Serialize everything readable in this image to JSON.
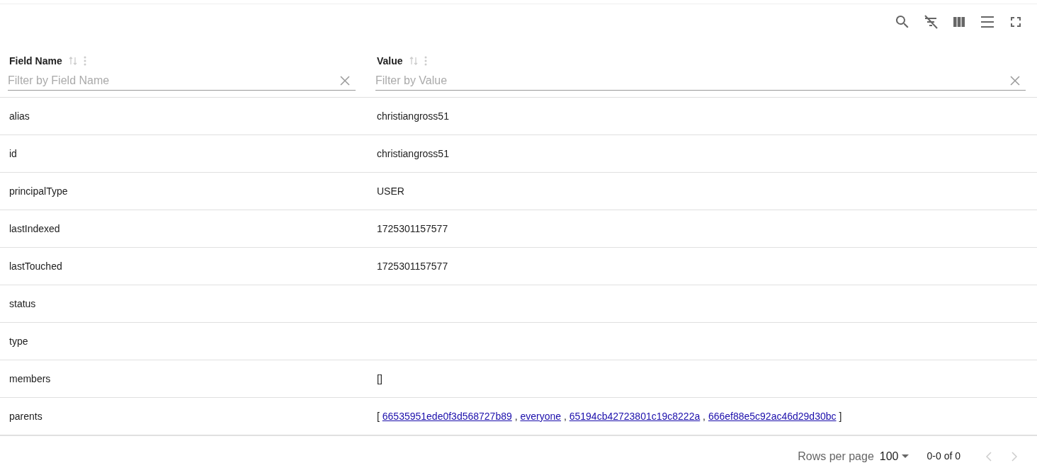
{
  "columns": [
    {
      "title": "Field Name",
      "filter_placeholder": "Filter by Field Name"
    },
    {
      "title": "Value",
      "filter_placeholder": "Filter by Value"
    }
  ],
  "rows": [
    {
      "field": "alias",
      "value": [
        {
          "kind": "text",
          "text": "christiangross51"
        }
      ]
    },
    {
      "field": "id",
      "value": [
        {
          "kind": "text",
          "text": "christiangross51"
        }
      ]
    },
    {
      "field": "principalType",
      "value": [
        {
          "kind": "text",
          "text": "USER"
        }
      ]
    },
    {
      "field": "lastIndexed",
      "value": [
        {
          "kind": "text",
          "text": "1725301157577"
        }
      ]
    },
    {
      "field": "lastTouched",
      "value": [
        {
          "kind": "text",
          "text": "1725301157577"
        }
      ]
    },
    {
      "field": "status",
      "value": []
    },
    {
      "field": "type",
      "value": []
    },
    {
      "field": "members",
      "value": [
        {
          "kind": "text",
          "text": "[]"
        }
      ]
    },
    {
      "field": "parents",
      "value": [
        {
          "kind": "text",
          "text": "[ "
        },
        {
          "kind": "link",
          "text": "66535951ede0f3d568727b89"
        },
        {
          "kind": "text",
          "text": " , "
        },
        {
          "kind": "link",
          "text": "everyone"
        },
        {
          "kind": "text",
          "text": " , "
        },
        {
          "kind": "link",
          "text": "65194cb42723801c19c8222a"
        },
        {
          "kind": "text",
          "text": " , "
        },
        {
          "kind": "link",
          "text": "666ef88e5c92ac46d29d30bc"
        },
        {
          "kind": "text",
          "text": " ]"
        }
      ]
    }
  ],
  "pagination": {
    "rows_per_page_label": "Rows per page",
    "rows_per_page": "100",
    "range": "0-0 of 0",
    "previous_disabled": true,
    "next_disabled": true
  }
}
